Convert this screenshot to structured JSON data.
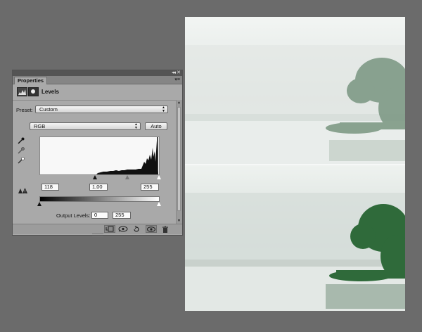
{
  "panel": {
    "tab_label": "Properties",
    "title": "Levels",
    "preset_label": "Preset:",
    "preset_value": "Custom",
    "channel_value": "RGB",
    "auto_label": "Auto",
    "input_black": "118",
    "input_gamma": "1,00",
    "input_white": "255",
    "output_label": "Output Levels:",
    "output_black": "0",
    "output_white": "255"
  },
  "icons": {
    "collapse": "double-arrow-icon",
    "close": "close-icon",
    "menu": "panel-menu-icon",
    "levels": "levels-adjustment-icon",
    "mask": "layer-mask-icon",
    "black_point": "eyedropper-black-icon",
    "gray_point": "eyedropper-gray-icon",
    "white_point": "eyedropper-white-icon",
    "clipping": "clipping-warning-icon",
    "clip_to_layer": "clip-to-layer-icon",
    "view_previous": "view-previous-state-icon",
    "reset": "reset-icon",
    "visibility": "eye-icon",
    "delete": "trash-icon"
  },
  "colors": {
    "workspace": "#6b6b6b",
    "panel": "#a9a9a9",
    "panel_dark": "#545454",
    "histogram_fill": "#111111"
  }
}
